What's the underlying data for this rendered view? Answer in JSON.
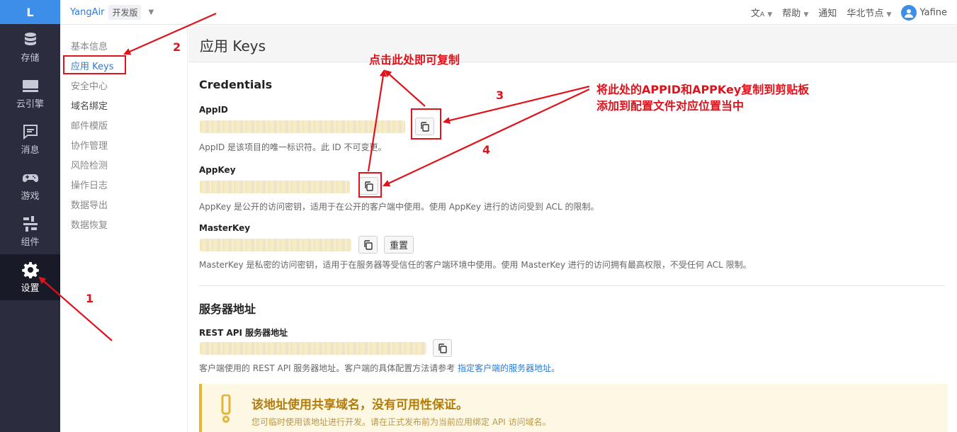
{
  "nav": {
    "logo": "L",
    "items": [
      {
        "label": "存储",
        "icon": "database-icon"
      },
      {
        "label": "云引擎",
        "icon": "server-icon"
      },
      {
        "label": "消息",
        "icon": "message-icon"
      },
      {
        "label": "游戏",
        "icon": "gamepad-icon"
      },
      {
        "label": "组件",
        "icon": "components-icon"
      },
      {
        "label": "设置",
        "icon": "gear-icon",
        "active": true
      }
    ]
  },
  "topbar": {
    "app_name": "YangAir",
    "edition": "开发版",
    "right": {
      "help": "帮助",
      "notify": "通知",
      "region": "华北节点",
      "user": "Yafine"
    }
  },
  "subnav": [
    "基本信息",
    "应用 Keys",
    "安全中心",
    "域名绑定",
    "邮件模版",
    "协作管理",
    "风险检测",
    "操作日志",
    "数据导出",
    "数据恢复"
  ],
  "page": {
    "title": "应用 Keys",
    "credentials_heading": "Credentials",
    "appid_label": "AppID",
    "appid_desc": "AppID 是该项目的唯一标识符。此 ID 不可变更。",
    "appkey_label": "AppKey",
    "appkey_desc": "AppKey 是公开的访问密钥，适用于在公开的客户端中使用。使用 AppKey 进行的访问受到 ACL 的限制。",
    "masterkey_label": "MasterKey",
    "masterkey_desc": "MasterKey 是私密的访问密钥，适用于在服务器等受信任的客户端环境中使用。使用 MasterKey 进行的访问拥有最高权限，不受任何 ACL 限制。",
    "reset_label": "重置",
    "server_heading": "服务器地址",
    "rest_label": "REST API 服务器地址",
    "rest_desc": "客户端使用的 REST API 服务器地址。客户端的具体配置方法请参考",
    "rest_link": "指定客户端的服务器地址",
    "rest_desc_end": "。",
    "warn_title": "该地址使用共享域名，没有可用性保证。",
    "warn_text": "您可临时使用该地址进行开发。请在正式发布前为当前应用绑定 API 访问域名。"
  },
  "annotations": {
    "n1": "1",
    "n2": "2",
    "n3": "3",
    "n4": "4",
    "copy_hint": "点击此处即可复制",
    "paste_hint_1": "将此处的APPID和APPKey复制到剪贴板",
    "paste_hint_2": "添加到配置文件对应位置当中",
    "color": "#e0121b"
  }
}
